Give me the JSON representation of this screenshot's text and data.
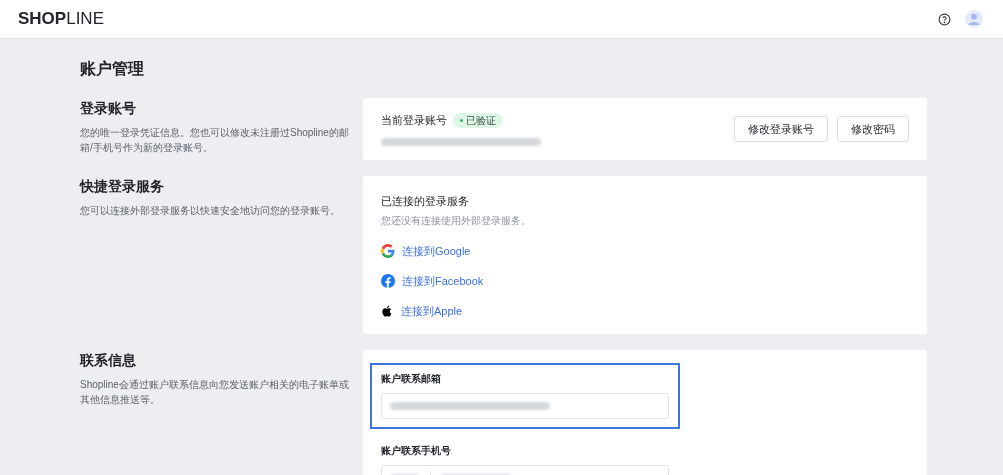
{
  "header": {
    "logo": "**SHOP**LINE"
  },
  "page": {
    "title": "账户管理"
  },
  "sections": [
    {
      "kind": "login",
      "title": "登录账号",
      "description": "您的唯一登录凭证信息。您也可以修改未注册过Shopline的邮箱/手机号作为新的登录账号。",
      "card": {
        "label": "当前登录账号",
        "badge": "已验证",
        "verified": true,
        "buttons": [
          "修改登录账号",
          "修改密码"
        ]
      }
    },
    {
      "kind": "services",
      "title": "快捷登录服务",
      "description": "您可以连接外部登录服务以快速安全地访问您的登录账号。",
      "card": {
        "label": "已连接的登录服务",
        "hint": "您还没有连接使用外部登录服务。",
        "links": [
          {
            "kind": "google",
            "label": "连接到Google"
          },
          {
            "kind": "facebook",
            "label": "连接到Facebook"
          },
          {
            "kind": "apple",
            "label": "连接到Apple"
          }
        ]
      }
    },
    {
      "kind": "contact",
      "title": "联系信息",
      "description": "Shopline会通过账户联系信息向您发送账户相关的电子账单或其他信息推送等。",
      "card": {
        "fields": [
          {
            "kind": "email",
            "label": "账户联系邮箱",
            "highlighted": true
          },
          {
            "kind": "phone",
            "label": "账户联系手机号",
            "highlighted": false
          }
        ]
      }
    }
  ]
}
